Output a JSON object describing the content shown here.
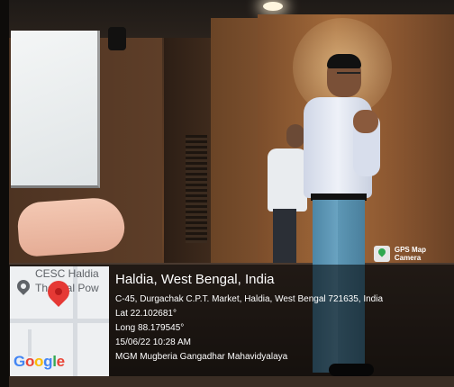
{
  "scene": {
    "description_hidden": "",
    "colors": {
      "map_pin": "#e53935",
      "overlay": "#000000",
      "badge_icon": "#2fa84f"
    }
  },
  "gps_badge": {
    "label": "GPS Map Camera",
    "icon": "map-camera-icon"
  },
  "map": {
    "poi_label_line1": "CESC Haldia",
    "poi_label_line2": "Thermal Pow",
    "google_logo": [
      "G",
      "o",
      "o",
      "g",
      "l",
      "e"
    ],
    "google_colors": [
      "#4285F4",
      "#EA4335",
      "#FBBC05",
      "#4285F4",
      "#34A853",
      "#EA4335"
    ],
    "pin_icon": "map-pin-icon",
    "poi_icon": "place-icon"
  },
  "location": {
    "title": "Haldia, West Bengal, India",
    "address": "C-45, Durgachak C.P.T. Market, Haldia, West Bengal 721635, India",
    "lat": "Lat 22.102681°",
    "long": "Long 88.179545°",
    "datetime": "15/06/22 10:28 AM",
    "note": "MGM Mugberia Gangadhar Mahavidyalaya"
  }
}
